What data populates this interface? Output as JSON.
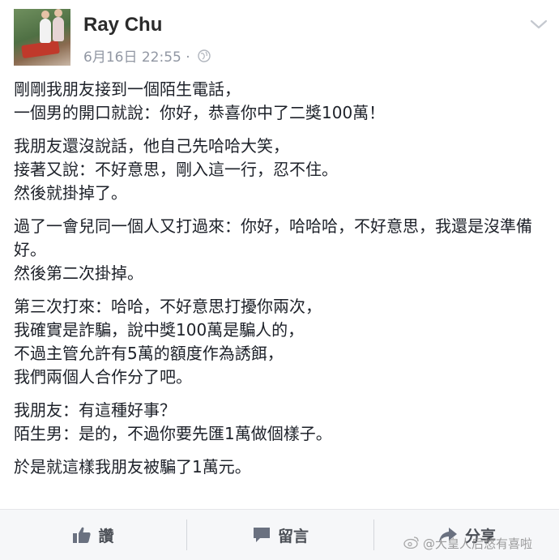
{
  "author": {
    "name": "Ray Chu",
    "date": "6月16日 22:55 ·",
    "privacy_icon": "globe-icon"
  },
  "post": {
    "paragraphs": [
      [
        "剛剛我朋友接到一個陌生電話，",
        "一個男的開口就說：你好，恭喜你中了二獎100萬！"
      ],
      [
        "我朋友還沒說話，他自己先哈哈大笑，",
        "接著又說：不好意思，剛入這一行，忍不住。",
        "然後就掛掉了。"
      ],
      [
        "過了一會兒同一個人又打過來：你好，哈哈哈，不好意思，我還是沒準備好。",
        "然後第二次掛掉。"
      ],
      [
        "第三次打來：哈哈，不好意思打擾你兩次，",
        "我確實是詐騙，說中獎100萬是騙人的，",
        "不過主管允許有5萬的額度作為誘餌，",
        "我們兩個人合作分了吧。"
      ],
      [
        "我朋友：有這種好事？",
        "陌生男：是的，不過你要先匯1萬做個樣子。"
      ],
      [
        "於是就這樣我朋友被騙了1萬元。"
      ]
    ]
  },
  "actions": {
    "like_label": "讚",
    "comment_label": "留言",
    "share_label": "分享"
  },
  "watermark": {
    "text": "@大皇人后悠有喜啦"
  },
  "colors": {
    "text": "#1d2129",
    "meta": "#9197a3",
    "bar_bg": "#f6f7f9",
    "bar_text": "#4b4f56"
  }
}
